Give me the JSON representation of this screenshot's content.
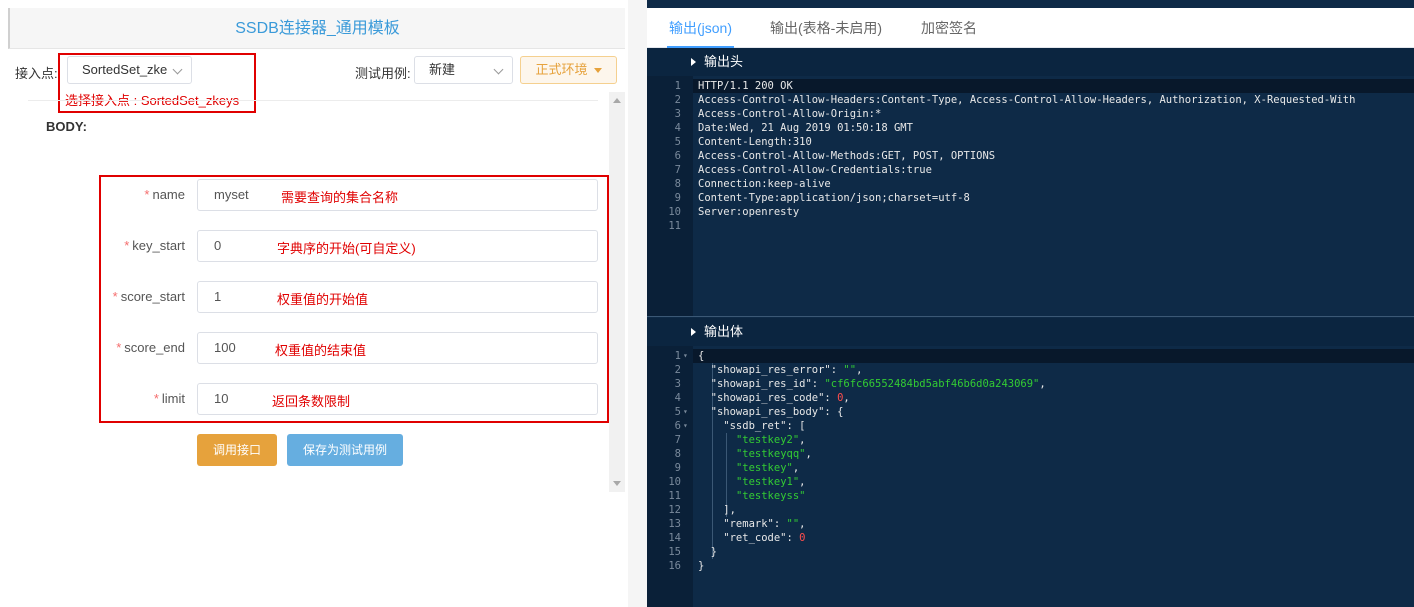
{
  "header": {
    "title": "SSDB连接器_通用模板"
  },
  "toolbar": {
    "endpoint_label": "接入点:",
    "endpoint_value": "SortedSet_zke",
    "testcase_label": "测试用例:",
    "testcase_value": "新建",
    "env_label": "正式环境"
  },
  "annotations": {
    "endpoint_note": "选择接入点 : SortedSet_zkeys",
    "name_note": "需要查询的集合名称",
    "key_start_note": "字典序的开始(可自定义)",
    "score_start_note": "权重值的开始值",
    "score_end_note": "权重值的结束值",
    "limit_note": "返回条数限制"
  },
  "form": {
    "section_label": "BODY:",
    "required_mark": "*",
    "fields": [
      {
        "label": "name",
        "value": "myset"
      },
      {
        "label": "key_start",
        "value": "0"
      },
      {
        "label": "score_start",
        "value": "1"
      },
      {
        "label": "score_end",
        "value": "100"
      },
      {
        "label": "limit",
        "value": "10"
      }
    ],
    "call_button": "调用接口",
    "save_button": "保存为测试用例"
  },
  "output": {
    "tabs": [
      {
        "label": "输出(json)",
        "active": true
      },
      {
        "label": "输出(表格-未启用)",
        "active": false
      },
      {
        "label": "加密签名",
        "active": false
      }
    ],
    "headers_title": "输出头",
    "headers_lines": [
      "HTTP/1.1 200 OK",
      "Access-Control-Allow-Headers:Content-Type, Access-Control-Allow-Headers, Authorization, X-Requested-With",
      "Access-Control-Allow-Origin:*",
      "Date:Wed, 21 Aug 2019 01:50:18 GMT",
      "Content-Length:310",
      "Access-Control-Allow-Methods:GET, POST, OPTIONS",
      "Access-Control-Allow-Credentials:true",
      "Connection:keep-alive",
      "Content-Type:application/json;charset=utf-8",
      "Server:openresty",
      ""
    ],
    "body_title": "输出体",
    "body_json": {
      "showapi_res_error": "",
      "showapi_res_id": "cf6fc66552484bd5abf46b6d0a243069",
      "showapi_res_code": 0,
      "showapi_res_body": {
        "ssdb_ret": [
          "testkey2",
          "testkeyqq",
          "testkey",
          "testkey1",
          "testkeyss"
        ],
        "remark": "",
        "ret_code": 0
      }
    }
  },
  "colors": {
    "accent_blue": "#409eff",
    "title_blue": "#3a9ad9",
    "annotation_red": "#e00000",
    "call_button": "#e6a23c",
    "save_button": "#66aee0",
    "editor_bg": "#0e2a47",
    "json_string": "#33cc33",
    "json_number": "#ff4d4d"
  }
}
